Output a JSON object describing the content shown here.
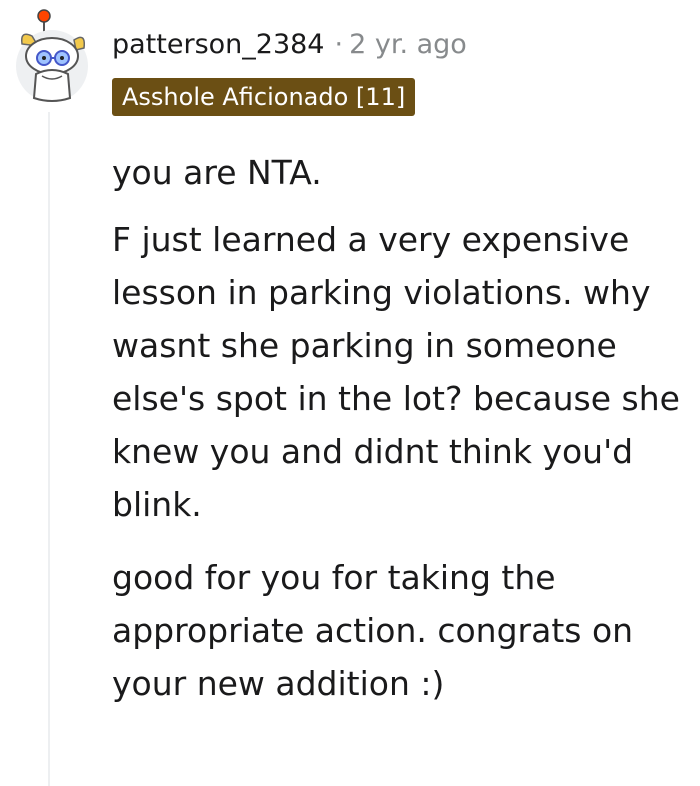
{
  "comment": {
    "username": "patterson_2384",
    "separator": "·",
    "timestamp": "2 yr. ago",
    "flair": "Asshole Aficionado [11]",
    "paragraphs": [
      "you are NTA.",
      "F just learned a very expensive lesson in parking violations. why wasnt she parking in someone else's spot in the lot? because she knew you and didnt think you'd blink.",
      "good for you for taking the appropriate action. congrats on your new addition :)"
    ]
  },
  "colors": {
    "flair_background": "#6b4f14",
    "meta_text": "#878a8c",
    "body_text": "#1a1a1b",
    "thread_line": "#edeff1"
  },
  "icons": {
    "avatar": "snoo-avatar-icon"
  }
}
